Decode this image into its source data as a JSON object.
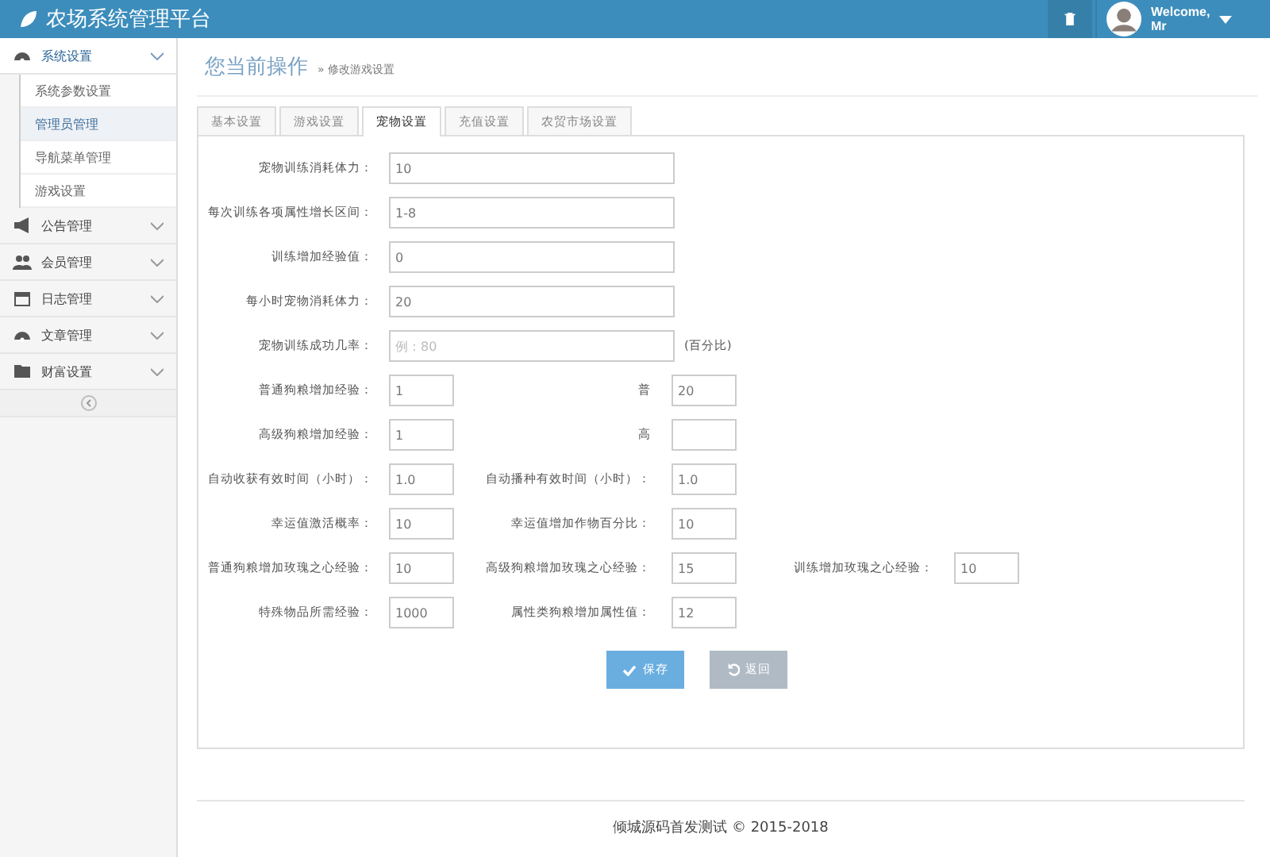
{
  "header": {
    "title": "农场系统管理平台",
    "user": "Welcome,\nMr"
  },
  "sidebar": {
    "groups": [
      {
        "label": "系统设置",
        "expanded": true,
        "children": [
          {
            "label": "系统参数设置",
            "selected": false
          },
          {
            "label": "管理员管理",
            "selected": true
          },
          {
            "label": "导航菜单管理",
            "selected": false
          },
          {
            "label": "游戏设置",
            "selected": false
          }
        ]
      },
      {
        "label": "公告管理",
        "expanded": false
      },
      {
        "label": "会员管理",
        "expanded": false
      },
      {
        "label": "日志管理",
        "expanded": false
      },
      {
        "label": "文章管理",
        "expanded": false
      },
      {
        "label": "财富设置",
        "expanded": false
      }
    ]
  },
  "breadcrumb": {
    "title": "您当前操作",
    "current": "» 修改游戏设置"
  },
  "tabs": [
    {
      "label": "基本设置",
      "selected": false
    },
    {
      "label": "游戏设置",
      "selected": false
    },
    {
      "label": "宠物设置",
      "selected": true
    },
    {
      "label": "充值设置",
      "selected": false
    },
    {
      "label": "农贸市场设置",
      "selected": false
    }
  ],
  "form": {
    "wide_rows": [
      {
        "label": "宠物训练消耗体力：",
        "value": "10"
      },
      {
        "label": "每次训练各项属性增长区间：",
        "value": "1-8"
      },
      {
        "label": "训练增加经验值：",
        "value": "0"
      },
      {
        "label": "每小时宠物消耗体力：",
        "value": "20"
      },
      {
        "label": "宠物训练成功几率：",
        "placeholder": "例：80",
        "suffix": "(百分比)"
      }
    ],
    "grid_rows": [
      [
        {
          "label": "普通狗粮增加经验：",
          "value": "1"
        },
        {
          "label": "普",
          "value": "20"
        }
      ],
      [
        {
          "label": "高级狗粮增加经验：",
          "value": "1"
        },
        {
          "label": "高"
        }
      ],
      [
        {
          "label": "自动收获有效时间（小时）：",
          "value": "1.0"
        },
        {
          "label": "自动播种有效时间（小时）：",
          "value": "1.0"
        }
      ],
      [
        {
          "label": "幸运值激活概率：",
          "value": "10"
        },
        {
          "label": "幸运值增加作物百分比：",
          "value": "10"
        }
      ],
      [
        {
          "label": "普通狗粮增加玫瑰之心经验：",
          "value": "10"
        },
        {
          "label": "高级狗粮增加玫瑰之心经验：",
          "value": "15"
        },
        {
          "label": "训练增加玫瑰之心经验：",
          "value": "10"
        }
      ],
      [
        {
          "label": "特殊物品所需经验：",
          "value": "1000"
        },
        {
          "label": "属性类狗粮增加属性值：",
          "value": "12"
        }
      ]
    ],
    "buttons": [
      {
        "label": "保存",
        "kind": "primary"
      },
      {
        "label": "返回",
        "kind": "secondary"
      }
    ]
  },
  "footer": "倾城源码首发测试 © 2015-2018"
}
